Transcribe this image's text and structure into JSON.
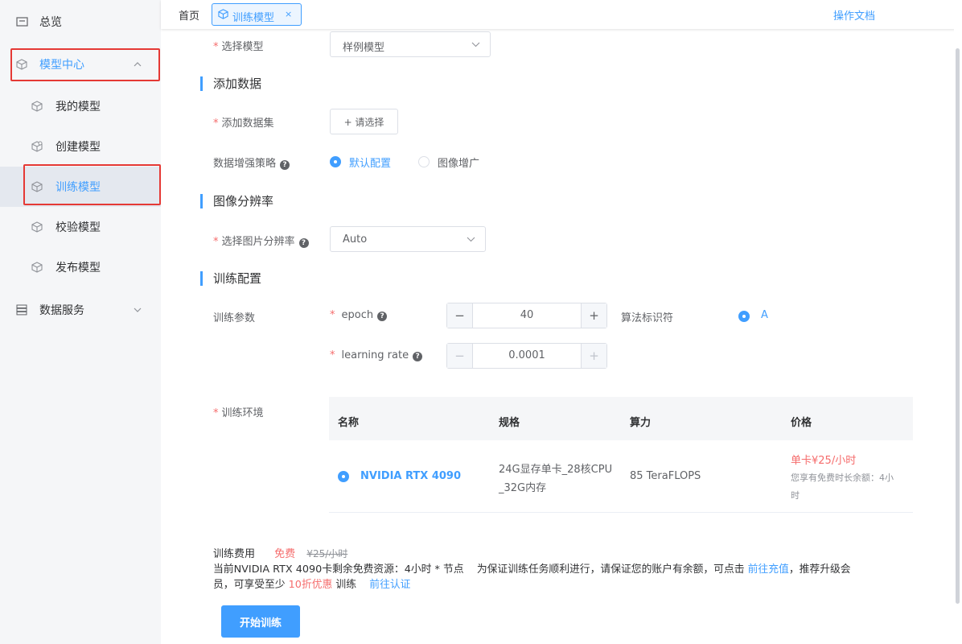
{
  "sidebar": {
    "overview": "总览",
    "model_center": "模型中心",
    "my_models": "我的模型",
    "create_model": "创建模型",
    "train_model": "训练模型",
    "verify_model": "校验模型",
    "publish_model": "发布模型",
    "data_service": "数据服务"
  },
  "topbar": {
    "home": "首页",
    "tab_label": "训练模型",
    "tab_close": "×",
    "doc_link": "操作文档"
  },
  "form": {
    "select_model_label": "选择模型",
    "select_model_value": "样例模型",
    "section_add_data": "添加数据",
    "add_dataset_label": "添加数据集",
    "add_dataset_button": "+ 请选择",
    "augment_label": "数据增强策略",
    "augment_help": "?",
    "augment_default": "默认配置",
    "augment_image": "图像增广",
    "section_resolution": "图像分辨率",
    "resolution_label": "选择图片分辨率",
    "resolution_help": "?",
    "resolution_value": "Auto",
    "section_train": "训练配置",
    "train_params_label": "训练参数",
    "epoch_label": "epoch",
    "epoch_help": "?",
    "epoch_value": "40",
    "lr_label": "learning rate",
    "lr_help": "?",
    "lr_value": "0.0001",
    "algo_label": "算法标识符",
    "algo_value": "A",
    "stepper_minus": "−",
    "stepper_plus": "+",
    "env_label": "训练环境"
  },
  "env_table": {
    "headers": [
      "名称",
      "规格",
      "算力",
      "价格"
    ],
    "row": {
      "name": "NVIDIA RTX 4090",
      "spec_line1": "24G显存单卡_28核CPU",
      "spec_line2": "_32G内存",
      "compute": "85 TeraFLOPS",
      "price": "单卡¥25/小时",
      "free_line1": "您享有免费时长余额：4小",
      "free_line2": "时"
    }
  },
  "fee": {
    "label": "训练费用",
    "free": "免费",
    "orig_price": "¥25/小时",
    "line1_part1": "当前NVIDIA RTX 4090卡剩余免费资源：4小时 * 节点    为保证训练任务顺利进行，请保证您的账户有余额，可点击 ",
    "recharge_link": "前往充值",
    "line1_part2": "，推荐升级会",
    "line2_part1": "员，可享受至少 ",
    "discount": "10折优惠",
    "line2_part2": " 训练    ",
    "verify_link": "前往认证"
  },
  "start_button": "开始训练",
  "colors": {
    "accent": "#409eff",
    "danger": "#f56c6c",
    "highlight_box": "#e53935"
  }
}
